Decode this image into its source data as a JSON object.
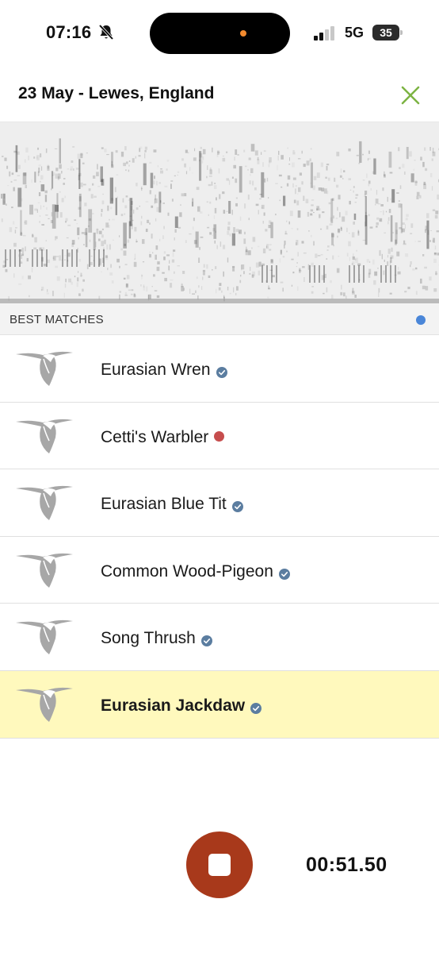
{
  "status_bar": {
    "time": "07:16",
    "network": "5G",
    "battery": "35",
    "icons": [
      "bell-muted-icon",
      "signal-icon",
      "battery-icon"
    ]
  },
  "header": {
    "title": "23 May - Lewes, England",
    "close_icon": "close-icon",
    "accent_color": "#7cb342"
  },
  "section": {
    "label": "BEST MATCHES",
    "status_dot_color": "#4a86d8"
  },
  "matches": [
    {
      "name": "Eurasian Wren",
      "status": "verified"
    },
    {
      "name": "Cetti's Warbler",
      "status": "not-verified"
    },
    {
      "name": "Eurasian Blue Tit",
      "status": "verified"
    },
    {
      "name": "Common Wood-Pigeon",
      "status": "verified"
    },
    {
      "name": "Song Thrush",
      "status": "verified"
    },
    {
      "name": "Eurasian Jackdaw",
      "status": "verified",
      "highlighted": true
    }
  ],
  "colors": {
    "verified": "#5b7da0",
    "not_verified": "#c64d4d",
    "highlight_row": "#fff9bd",
    "stop_button": "#a8391b"
  },
  "recording": {
    "timer": "00:51.50",
    "stop_icon": "stop-icon"
  }
}
